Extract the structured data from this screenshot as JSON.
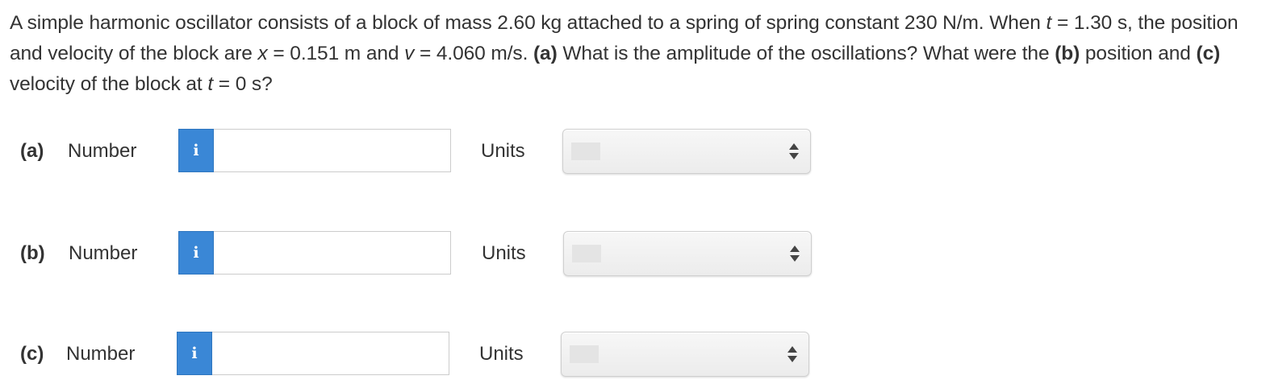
{
  "question": {
    "t1": "A simple harmonic oscillator consists of a block of mass 2.60 kg attached to a spring of spring constant 230 N/m. When ",
    "t_var1": "t",
    "t2": " = 1.30 s, the position and velocity of the block are ",
    "x_var": "x",
    "t3": " = 0.151 m and ",
    "v_var": "v",
    "t4": " = 4.060 m/s. ",
    "a_bold": "(a)",
    "t5": " What is the amplitude of the oscillations? What were the ",
    "b_bold": "(b)",
    "t6": " position and ",
    "c_bold": "(c)",
    "t7": " velocity of the block at ",
    "t_var2": "t",
    "t8": " = 0 s?"
  },
  "answers": [
    {
      "part": "(a)",
      "number_label": "Number",
      "info_icon": "i",
      "value": "",
      "units_label": "Units",
      "units_selected": ""
    },
    {
      "part": "(b)",
      "number_label": "Number",
      "info_icon": "i",
      "value": "",
      "units_label": "Units",
      "units_selected": ""
    },
    {
      "part": "(c)",
      "number_label": "Number",
      "info_icon": "i",
      "value": "",
      "units_label": "Units",
      "units_selected": ""
    }
  ],
  "colors": {
    "info_button": "#3a87d6",
    "text": "#333333"
  },
  "icons": {
    "info": "info-icon",
    "select_arrows": "up-down-arrows-icon"
  }
}
